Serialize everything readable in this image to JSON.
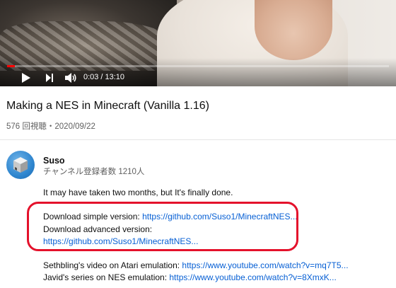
{
  "player": {
    "progress": 0.004,
    "time_current": "0:03",
    "time_separator": "/",
    "time_total": "13:10",
    "icons": [
      "play-icon",
      "next-icon",
      "volume-icon"
    ]
  },
  "video": {
    "title": "Making a NES in Minecraft (Vanilla 1.16)",
    "meta": "576 回視聴・2020/09/22"
  },
  "channel": {
    "name": "Suso",
    "subscribers": "チャンネル登録者数 1210人"
  },
  "description": {
    "intro": "It may have taken two months, but It's finally done.",
    "simple_label": "Download simple version: ",
    "simple_link": "https://github.com/Suso1/MinecraftNES...",
    "advanced_label": "Download advanced version:",
    "advanced_link": "https://github.com/Suso1/MinecraftNES...",
    "sethbling_label": "Sethbling's video on Atari emulation: ",
    "sethbling_link": "https://www.youtube.com/watch?v=mq7T5...",
    "javid_label": "Javid's series on NES emulation: ",
    "javid_link": "https://www.youtube.com/watch?v=8XmxK..."
  },
  "colors": {
    "accent_red": "#ff0000",
    "highlight_border": "#e4112b",
    "link": "#065fd4",
    "meta_text": "#606060"
  }
}
